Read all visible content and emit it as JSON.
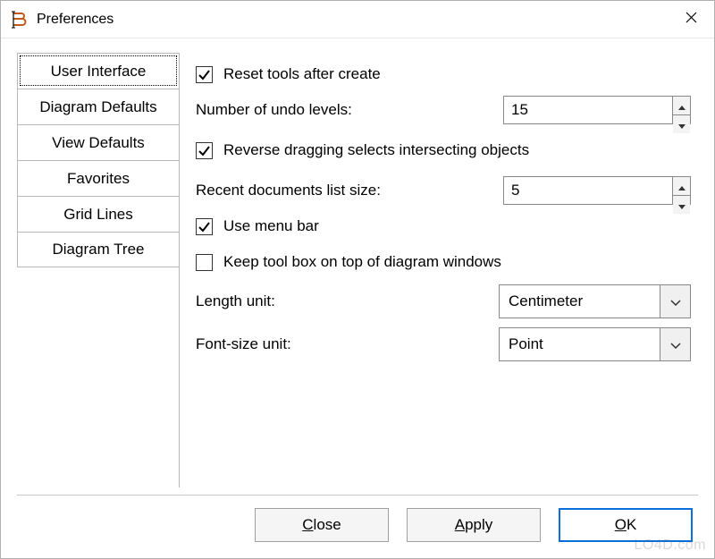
{
  "window": {
    "title": "Preferences"
  },
  "tabs": [
    {
      "label": "User Interface"
    },
    {
      "label": "Diagram Defaults"
    },
    {
      "label": "View Defaults"
    },
    {
      "label": "Favorites"
    },
    {
      "label": "Grid Lines"
    },
    {
      "label": "Diagram Tree"
    }
  ],
  "panel": {
    "reset_tools_label": "Reset tools after create",
    "reset_tools_checked": true,
    "undo_label": "Number of undo levels:",
    "undo_value": "15",
    "reverse_drag_label": "Reverse dragging selects intersecting objects",
    "reverse_drag_checked": true,
    "recent_label": "Recent documents list size:",
    "recent_value": "5",
    "menu_bar_label": "Use menu bar",
    "menu_bar_checked": true,
    "keep_toolbox_label": "Keep tool box on top of diagram windows",
    "keep_toolbox_checked": false,
    "length_unit_label": "Length unit:",
    "length_unit_value": "Centimeter",
    "font_unit_label": "Font-size unit:",
    "font_unit_value": "Point"
  },
  "buttons": {
    "close": "Close",
    "apply": "Apply",
    "ok": "OK"
  },
  "watermark": "LO4D.com"
}
